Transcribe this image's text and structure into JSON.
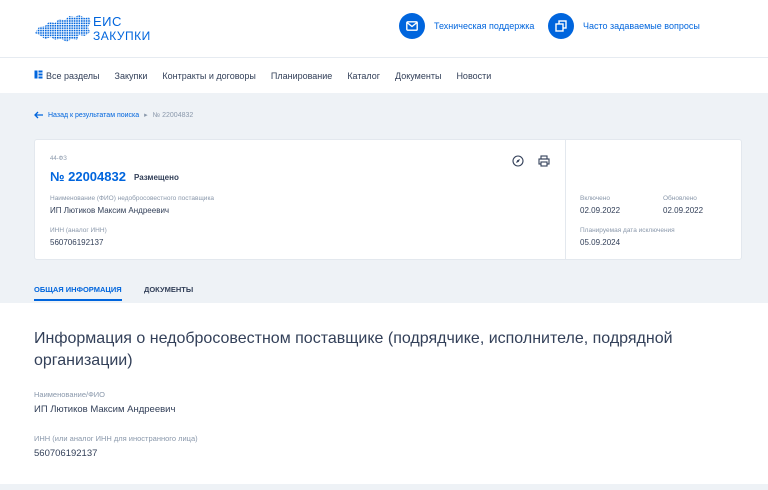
{
  "header": {
    "logo_line1": "ЕИС",
    "logo_line2": "ЗАКУПКИ",
    "support_label": "Техническая поддержка",
    "faq_label": "Часто задаваемые вопросы"
  },
  "nav": {
    "items": [
      "Все разделы",
      "Закупки",
      "Контракты и договоры",
      "Планирование",
      "Каталог",
      "Документы",
      "Новости"
    ]
  },
  "breadcrumb": {
    "back": "Назад к результатам поиска",
    "current": "№ 22004832"
  },
  "card": {
    "law": "44-ФЗ",
    "number": "№ 22004832",
    "status": "Размещено",
    "name_label": "Наименование (ФИО) недобросовестного поставщика",
    "name_value": "ИП Лютиков Максим Андреевич",
    "inn_label": "ИНН (аналог ИНН)",
    "inn_value": "560706192137",
    "included_label": "Включено",
    "included_value": "02.09.2022",
    "updated_label": "Обновлено",
    "updated_value": "02.09.2022",
    "exclusion_label": "Планируемая дата исключения",
    "exclusion_value": "05.09.2024"
  },
  "tabs": {
    "general": "ОБЩАЯ ИНФОРМАЦИЯ",
    "documents": "ДОКУМЕНТЫ"
  },
  "main": {
    "title": "Информация о недобросовестном поставщике (подрядчике, исполнителе, подрядной организации)",
    "name_label": "Наименование/ФИО",
    "name_value": "ИП Лютиков Максим Андреевич",
    "inn_label": "ИНН (или аналог ИНН для иностранного лица)",
    "inn_value": "560706192137"
  },
  "colors": {
    "accent": "#0065dd",
    "text": "#334059",
    "muted": "#8a98ab",
    "band": "#eef2f6"
  }
}
